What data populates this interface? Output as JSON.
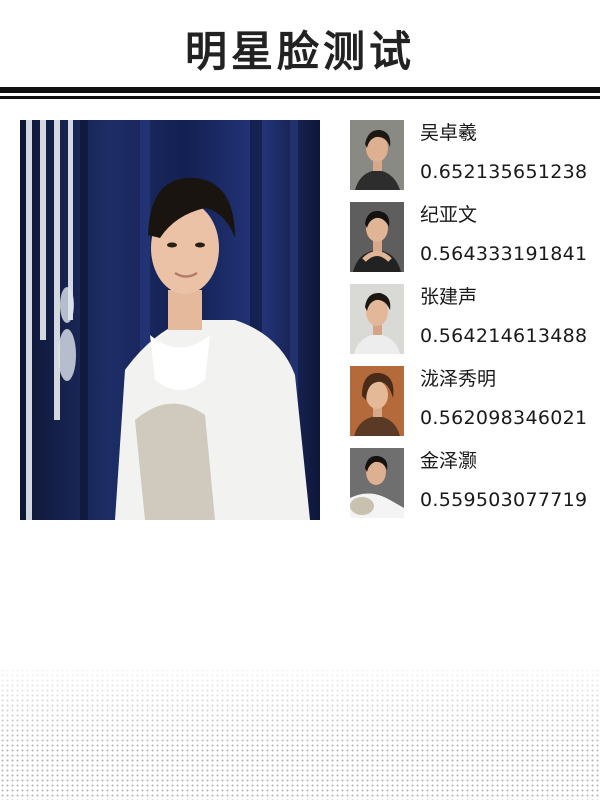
{
  "header": {
    "title": "明星脸测试"
  },
  "query_photo": {
    "kind": "uploaded-portrait-photo"
  },
  "matches": [
    {
      "name": "吴卓羲",
      "score": "0.652135651238"
    },
    {
      "name": "纪亚文",
      "score": "0.564333191841"
    },
    {
      "name": "张建声",
      "score": "0.564214613488"
    },
    {
      "name": "泷泽秀明",
      "score": "0.562098346021"
    },
    {
      "name": "金泽灏",
      "score": "0.559503077719"
    }
  ],
  "colors": {
    "rule": "#111111",
    "text": "#1a1a1a",
    "photo_backdrop": "#1d2d66"
  }
}
